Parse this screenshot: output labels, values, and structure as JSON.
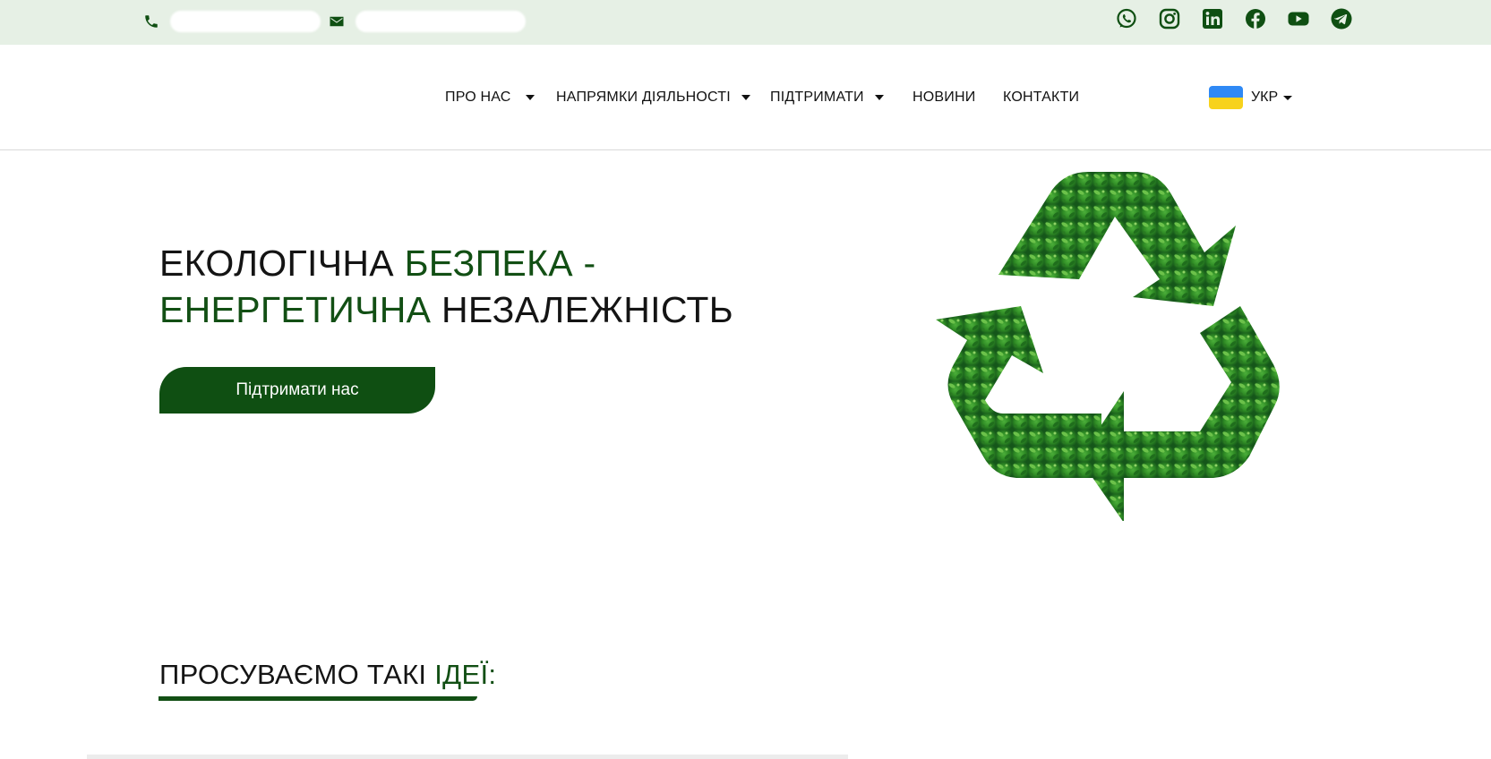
{
  "topbar": {
    "phone_icon": "phone-icon",
    "email_icon": "envelope-icon",
    "socials": [
      "whatsapp-icon",
      "instagram-icon",
      "linkedin-icon",
      "facebook-icon",
      "youtube-icon",
      "telegram-icon"
    ]
  },
  "nav": {
    "items": [
      {
        "label": "ПРО НАС",
        "has_dropdown": true
      },
      {
        "label": "НАПРЯМКИ ДІЯЛЬНОСТІ",
        "has_dropdown": true
      },
      {
        "label": "ПІДТРИМАТИ",
        "has_dropdown": true
      },
      {
        "label": "НОВИНИ",
        "has_dropdown": false
      },
      {
        "label": "КОНТАКТИ",
        "has_dropdown": false
      }
    ],
    "language": {
      "label": "УКР",
      "flag": "ukraine-flag"
    }
  },
  "hero": {
    "title_part1": "ЕКОЛОГІЧНА ",
    "title_part2": "БЕЗПЕКА -",
    "title_part3": "ЕНЕРГЕТИЧНА",
    "title_part4": " НЕЗАЛЕЖНІСТЬ",
    "cta_label": "Підтримати нас",
    "image": "green-recycle-symbol-image"
  },
  "ideas": {
    "title_part1": "ПРОСУВАЄМО ТАКІ ",
    "title_part2": "ІДЕЇ:"
  },
  "colors": {
    "topbar_bg": "#e6f0e5",
    "accent_green": "#124f14",
    "button_green": "#0f4f12"
  }
}
